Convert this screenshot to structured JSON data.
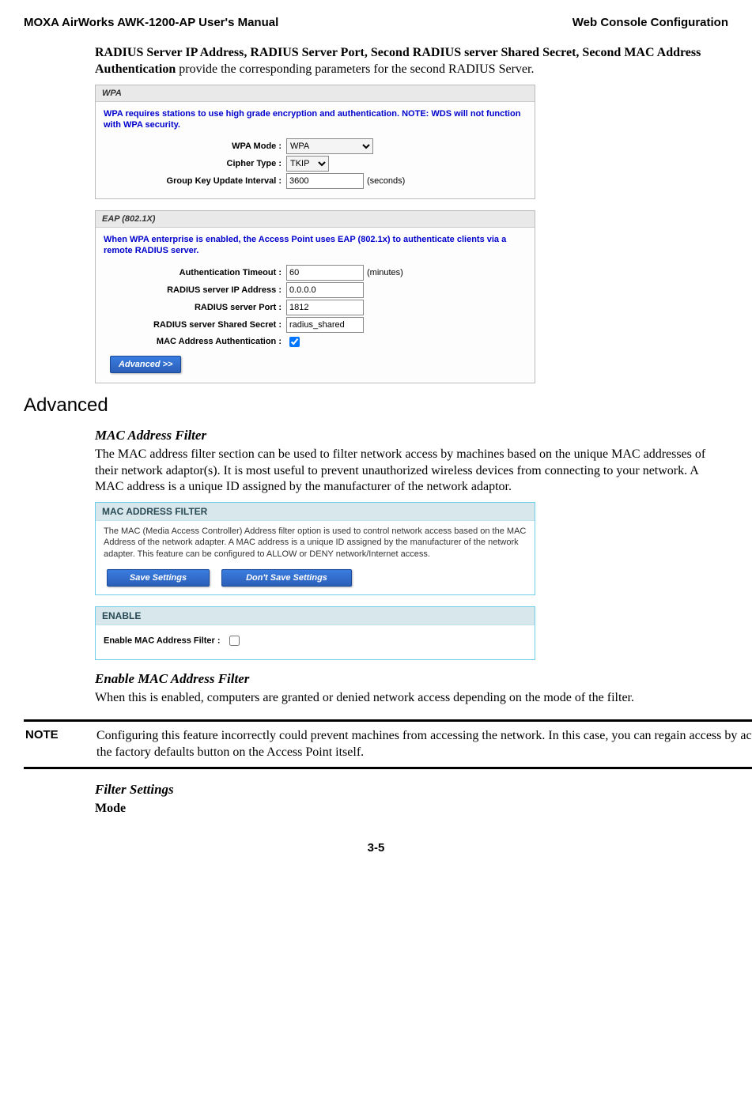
{
  "header": {
    "left": "MOXA AirWorks AWK-1200-AP User's Manual",
    "right": "Web Console Configuration"
  },
  "radius_para_lead": "RADIUS Server IP Address, RADIUS Server Port, Second RADIUS server Shared Secret, Second MAC Address Authentication",
  "radius_para_tail": " provide the corresponding parameters for the second RADIUS Server.",
  "wpa_panel": {
    "title": "WPA",
    "desc": "WPA requires stations to use high grade encryption and authentication. NOTE: WDS will not function with WPA security.",
    "rows": {
      "mode_label": "WPA Mode :",
      "mode_value": "WPA",
      "cipher_label": "Cipher Type :",
      "cipher_value": "TKIP",
      "gkui_label": "Group Key Update Interval :",
      "gkui_value": "3600",
      "gkui_suffix": "(seconds)"
    }
  },
  "eap_panel": {
    "title": "EAP (802.1X)",
    "desc": "When WPA enterprise is enabled, the Access Point uses EAP (802.1x) to authenticate clients via a remote RADIUS server.",
    "rows": {
      "auth_timeout_label": "Authentication Timeout :",
      "auth_timeout_value": "60",
      "auth_timeout_suffix": "(minutes)",
      "rad_ip_label": "RADIUS server IP Address :",
      "rad_ip_value": "0.0.0.0",
      "rad_port_label": "RADIUS server Port :",
      "rad_port_value": "1812",
      "rad_secret_label": "RADIUS server Shared Secret :",
      "rad_secret_value": "radius_shared",
      "mac_auth_label": "MAC Address Authentication :"
    },
    "advanced_btn": "Advanced >>"
  },
  "advanced_heading": "Advanced",
  "mac_filter_heading": "MAC Address Filter",
  "mac_filter_para": "The MAC address filter section can be used to filter network access by machines based on the unique MAC addresses of their network adaptor(s). It is most useful to prevent unauthorized wireless devices from connecting to your network. A MAC address is a unique ID assigned by the manufacturer of the network adaptor.",
  "mac_box1": {
    "title": "MAC ADDRESS FILTER",
    "desc": "The MAC (Media Access Controller) Address filter option is used to control network access based on the MAC Address of the network adapter. A MAC address is a unique ID assigned by the manufacturer of the network adapter. This feature can be configured to ALLOW or DENY network/Internet access.",
    "save_btn": "Save Settings",
    "dont_save_btn": "Don't Save Settings"
  },
  "mac_box2": {
    "title": "ENABLE",
    "enable_label": "Enable MAC Address Filter :"
  },
  "enable_heading": "Enable MAC Address Filter",
  "enable_para": "When this is enabled, computers are granted or denied network access depending on the mode of the filter.",
  "note": {
    "label": "NOTE",
    "text": "Configuring this feature incorrectly could prevent machines from accessing the network. In this case, you can regain access by activating the factory defaults button on the Access Point itself."
  },
  "filter_settings_heading": "Filter Settings",
  "mode_heading": "Mode",
  "page_num": "3-5"
}
